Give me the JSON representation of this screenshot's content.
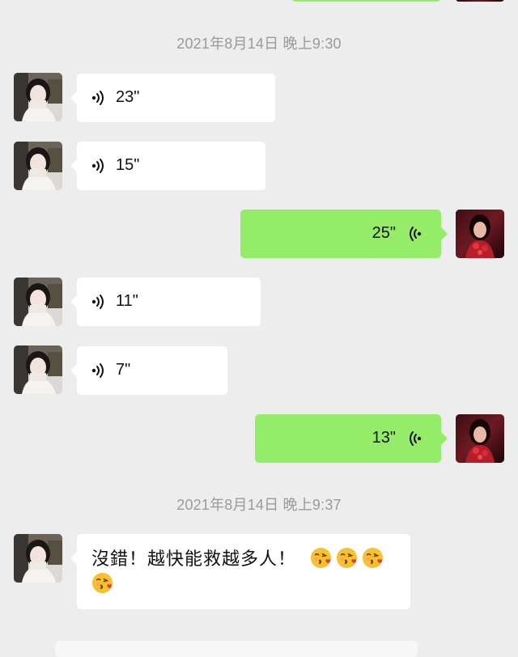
{
  "timestamps": [
    "2021年8月14日 晚上9:30",
    "2021年8月14日 晚上9:37"
  ],
  "messages": [
    {
      "direction": "incoming",
      "type": "voice",
      "duration": "23\""
    },
    {
      "direction": "incoming",
      "type": "voice",
      "duration": "15\""
    },
    {
      "direction": "outgoing",
      "type": "voice",
      "duration": "25\""
    },
    {
      "direction": "incoming",
      "type": "voice",
      "duration": "11\""
    },
    {
      "direction": "incoming",
      "type": "voice",
      "duration": "7\""
    },
    {
      "direction": "outgoing",
      "type": "voice",
      "duration": "13\""
    },
    {
      "direction": "incoming",
      "type": "text",
      "text": "沒錯！越快能救越多人！",
      "emoji": [
        "kissing-heart-emoji",
        "kissing-heart-emoji",
        "kissing-heart-emoji",
        "kissing-heart-emoji"
      ]
    }
  ],
  "colors": {
    "background": "#ededed",
    "incoming_bubble": "#ffffff",
    "outgoing_bubble": "#95ec69",
    "timestamp": "#9a9a9a"
  },
  "icons": {
    "voice_in": "voice-wave-icon",
    "voice_out": "voice-wave-icon",
    "emoji": "kissing-heart-emoji"
  }
}
